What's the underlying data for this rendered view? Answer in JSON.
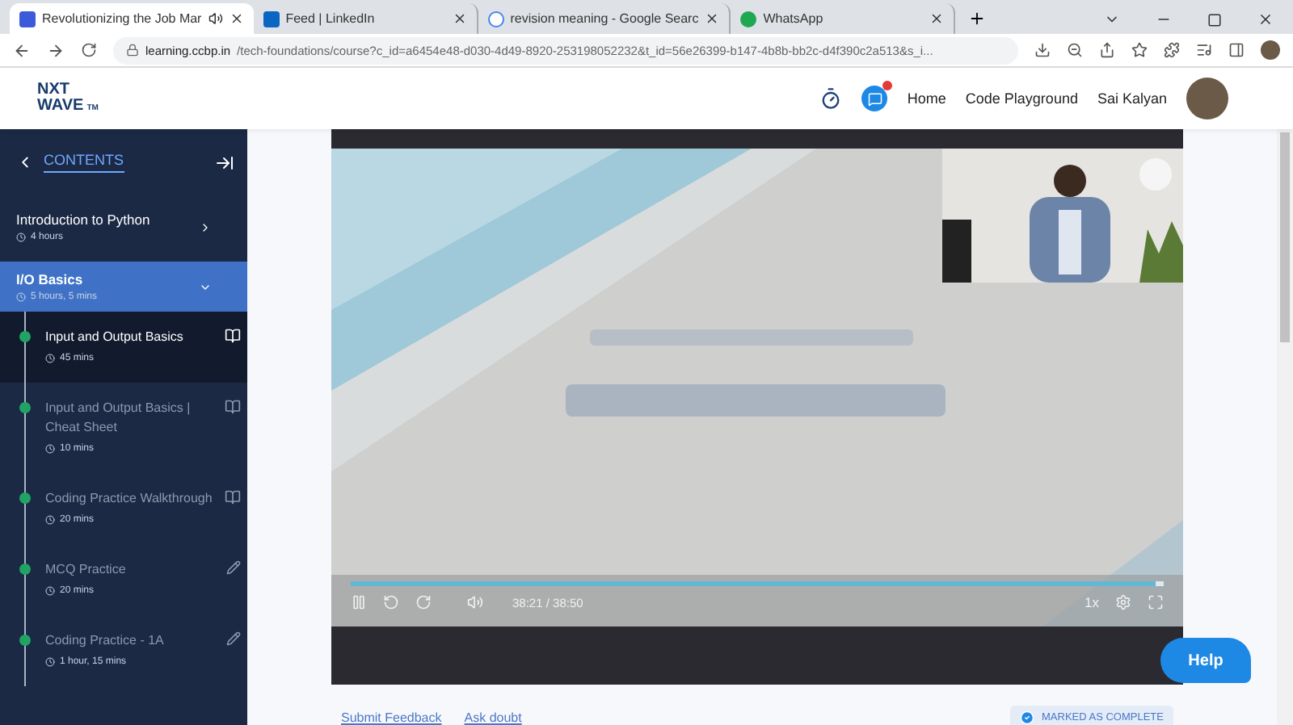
{
  "browser": {
    "tabs": [
      {
        "title": "Revolutionizing the Job Mar",
        "kind": "ccbp",
        "selected": true,
        "audio": true
      },
      {
        "title": "Feed | LinkedIn",
        "kind": "linkedin",
        "selected": false,
        "audio": false
      },
      {
        "title": "revision meaning - Google Searc",
        "kind": "google",
        "selected": false,
        "audio": false
      },
      {
        "title": "WhatsApp",
        "kind": "whatsapp",
        "selected": false,
        "audio": false
      }
    ],
    "url_host": "learning.ccbp.in",
    "url_path": "/tech-foundations/course?c_id=a6454e48-d030-4d49-8920-253198052232&t_id=56e26399-b147-4b8b-bb2c-d4f390c2a513&s_i..."
  },
  "header": {
    "logo": [
      "NXT",
      "WAVE"
    ],
    "logo_mark": "TM",
    "nav": [
      "Home",
      "Code Playground"
    ],
    "user": "Sai Kalyan"
  },
  "sidebar": {
    "title": "CONTENTS",
    "sections": [
      {
        "title": "Introduction to Python",
        "duration": "4 hours",
        "expanded": false
      },
      {
        "title": "I/O Basics",
        "duration": "5 hours, 5 mins",
        "expanded": true,
        "items": [
          {
            "title": "Input and Output Basics",
            "duration": "45 mins",
            "kind": "reading",
            "selected": true,
            "completed": true
          },
          {
            "title": "Input and Output Basics | Cheat Sheet",
            "duration": "10 mins",
            "kind": "reading",
            "selected": false,
            "completed": true
          },
          {
            "title": "Coding Practice Walkthrough",
            "duration": "20 mins",
            "kind": "reading",
            "selected": false,
            "completed": true
          },
          {
            "title": "MCQ Practice",
            "duration": "20 mins",
            "kind": "practice",
            "selected": false,
            "completed": true
          },
          {
            "title": "Coding Practice - 1A",
            "duration": "1 hour, 15 mins",
            "kind": "practice",
            "selected": false,
            "completed": true
          }
        ]
      }
    ]
  },
  "player": {
    "time": "38:21 / 38:50",
    "speed": "1x",
    "level": 0.99,
    "playing": true
  },
  "footer": {
    "links": [
      "Submit Feedback",
      "Ask doubt"
    ],
    "complete_button": "MARKED AS COMPLETE",
    "completed": true
  },
  "help_button": "Help"
}
